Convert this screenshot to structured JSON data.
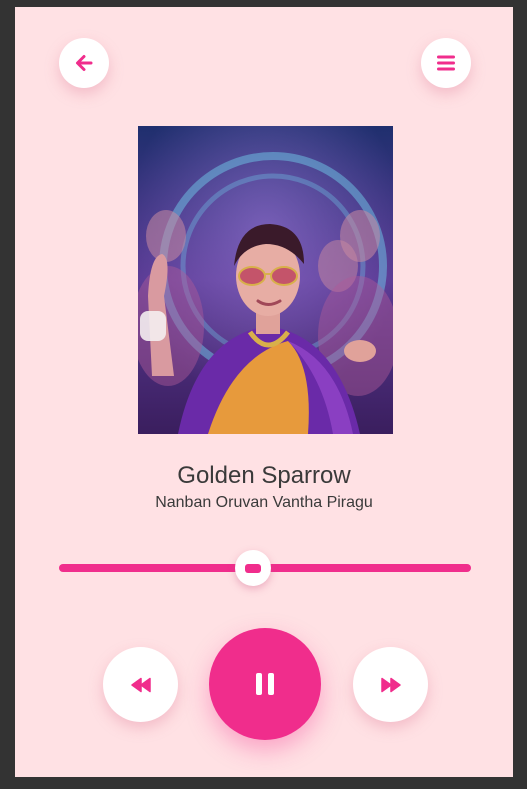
{
  "song": {
    "title": "Golden Sparrow",
    "artist": "Nanban Oruvan Vantha Piragu"
  },
  "progress": 0.47,
  "controls": {
    "back_icon": "arrow-left-icon",
    "menu_icon": "hamburger-menu-icon",
    "prev_icon": "rewind-icon",
    "play_icon": "pause-icon",
    "next_icon": "fast-forward-icon"
  },
  "colors": {
    "accent": "#f02d8c",
    "background": "#ffe1e4",
    "frame": "#333333"
  }
}
